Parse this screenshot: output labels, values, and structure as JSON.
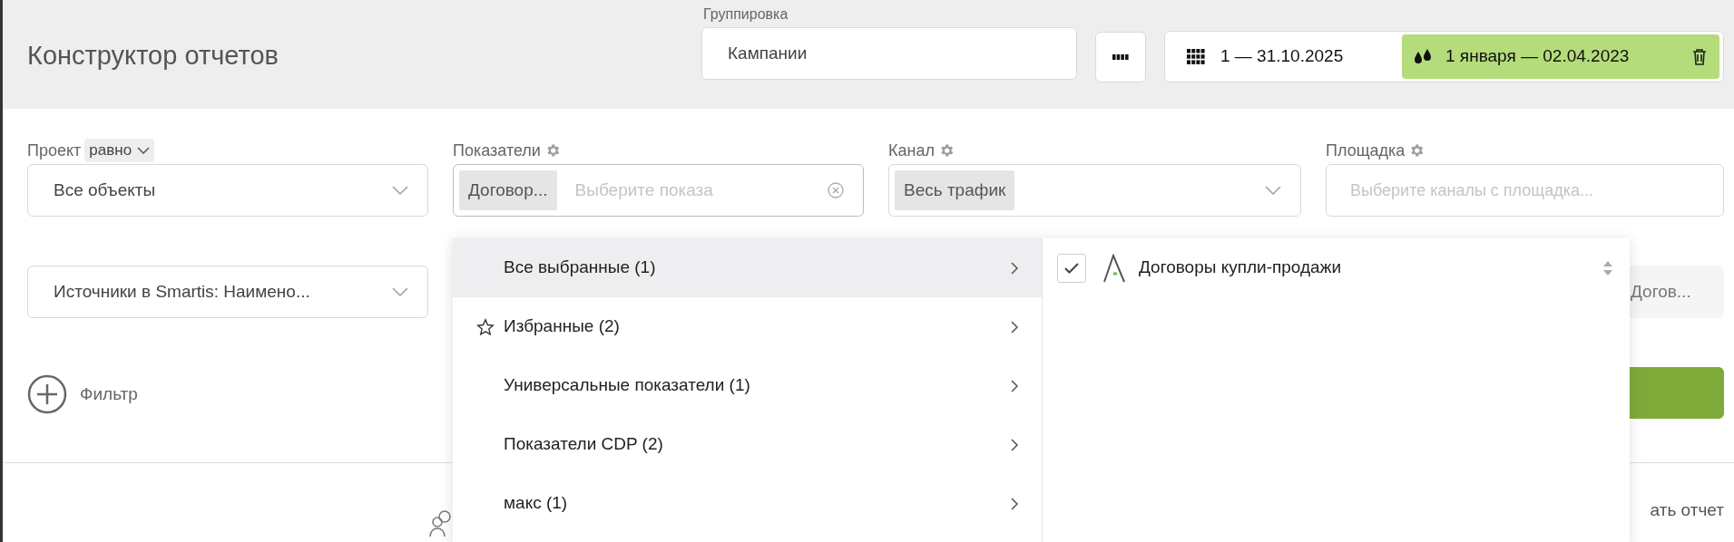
{
  "header": {
    "title": "Конструктор отчетов",
    "grouping": {
      "label": "Группировка",
      "value": "Кампании"
    },
    "period": {
      "range": "1 — 31.10.2025",
      "compare_range": "1 января — 02.04.2023"
    }
  },
  "project": {
    "label": "Проект",
    "operator": "равно",
    "value": "Все объекты"
  },
  "metrics": {
    "label": "Показатели",
    "tag": "Договор...",
    "placeholder": "Выберите показа"
  },
  "channel": {
    "label": "Канал",
    "tag": "Весь трафик"
  },
  "platform": {
    "label": "Площадка",
    "placeholder": "Выберите каналы с площадка..."
  },
  "source_select": {
    "value": "Источники в Smartis: Наимено..."
  },
  "partial_chip": "Догов...",
  "add_filter": "Фильтр",
  "partial_link": "ать отчет",
  "dropdown": {
    "categories": [
      {
        "label": "Все выбранные (1)",
        "kind": "plain",
        "selected": true
      },
      {
        "label": "Избранные (2)",
        "kind": "favorites",
        "selected": false
      },
      {
        "label": "Универсальные показатели (1)",
        "kind": "plain",
        "selected": false
      },
      {
        "label": "Показатели CDP (2)",
        "kind": "plain",
        "selected": false
      },
      {
        "label": "макс (1)",
        "kind": "plain",
        "selected": false
      }
    ],
    "items": [
      {
        "label": "Договоры купли-продажи",
        "checked": true
      }
    ]
  }
}
